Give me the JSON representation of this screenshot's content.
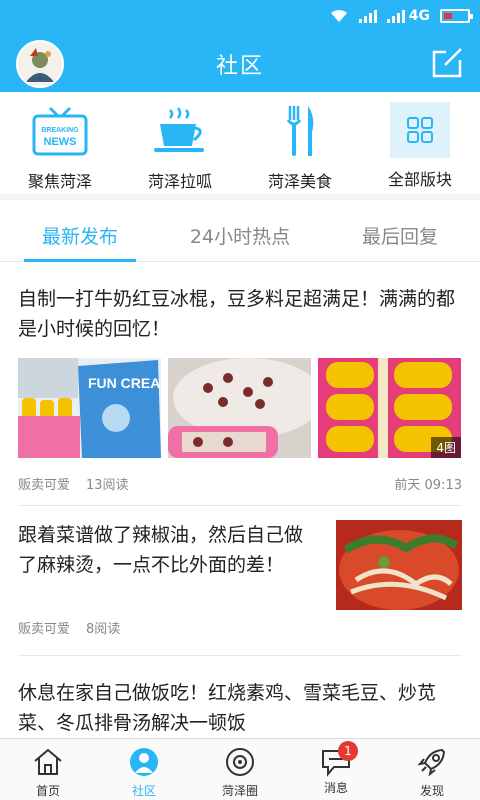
{
  "status_bar": {
    "network": "4G"
  },
  "header": {
    "title": "社区"
  },
  "quick_links": [
    {
      "label": "聚焦菏泽",
      "icon": "news-tv-icon",
      "badge_text": "BREAKING NEWS"
    },
    {
      "label": "菏泽拉呱",
      "icon": "coffee-cup-icon"
    },
    {
      "label": "菏泽美食",
      "icon": "fork-knife-icon"
    },
    {
      "label": "全部版块",
      "icon": "grid-icon"
    }
  ],
  "tabs": [
    {
      "label": "最新发布",
      "active": true
    },
    {
      "label": "24小时热点",
      "active": false
    },
    {
      "label": "最后回复",
      "active": false
    }
  ],
  "posts": [
    {
      "title": "自制一打牛奶红豆冰棍，豆多料足超满足！满满的都是小时候的回忆！",
      "author": "贩卖可爱",
      "reads": "13阅读",
      "time": "前天 09:13",
      "image_count": "4图",
      "photo_text": "FUN CREAM"
    },
    {
      "title": "跟着菜谱做了辣椒油，然后自己做了麻辣烫，一点不比外面的差！",
      "author": "贩卖可爱",
      "reads": "8阅读"
    },
    {
      "title": "休息在家自己做饭吃！红烧素鸡、雪菜毛豆、炒苋菜、冬瓜排骨汤解决一顿饭"
    }
  ],
  "bottom_nav": [
    {
      "label": "首页",
      "icon": "home-icon"
    },
    {
      "label": "社区",
      "icon": "community-icon",
      "active": true
    },
    {
      "label": "菏泽圈",
      "icon": "circle-icon"
    },
    {
      "label": "消息",
      "icon": "message-icon",
      "badge": "1"
    },
    {
      "label": "发现",
      "icon": "rocket-icon"
    }
  ],
  "colors": {
    "accent": "#29b6f6",
    "badge": "#e53935"
  }
}
